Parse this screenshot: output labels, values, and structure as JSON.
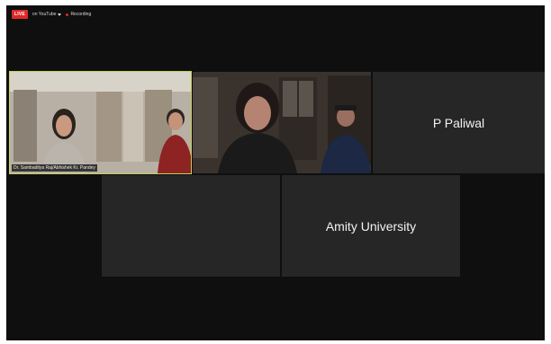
{
  "topbar": {
    "live_label": "LIVE",
    "youtube_label": "on YouTube",
    "recording_label": "Recording"
  },
  "tiles": [
    {
      "name": "Dr. Sambaditya Raj/Abhishek Kr. Pandey",
      "type": "video",
      "active_speaker": true
    },
    {
      "name": "",
      "type": "video",
      "active_speaker": false
    },
    {
      "name": "P Paliwal",
      "type": "name"
    },
    {
      "name": "",
      "type": "empty"
    },
    {
      "name": "Amity University",
      "type": "name"
    }
  ],
  "colors": {
    "background": "#0f0f0f",
    "tile": "#262626",
    "active_border": "#c5d25a",
    "live": "#e02828"
  }
}
